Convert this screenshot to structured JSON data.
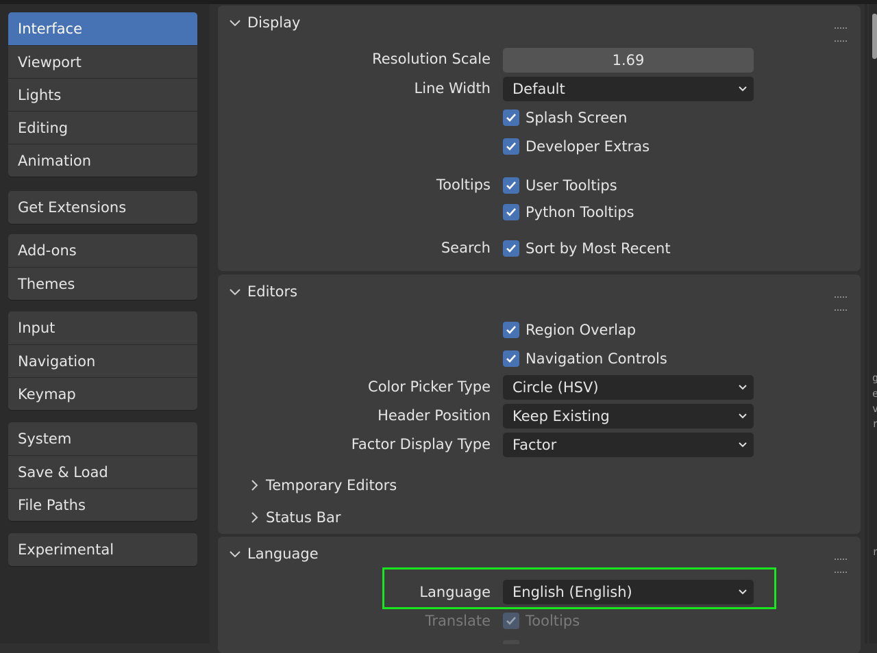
{
  "sidebar": {
    "groups": [
      [
        "Interface",
        "Viewport",
        "Lights",
        "Editing",
        "Animation"
      ],
      [
        "Get Extensions"
      ],
      [
        "Add-ons",
        "Themes"
      ],
      [
        "Input",
        "Navigation",
        "Keymap"
      ],
      [
        "System",
        "Save & Load",
        "File Paths"
      ],
      [
        "Experimental"
      ]
    ],
    "active": "Interface"
  },
  "display": {
    "title": "Display",
    "resolution_scale_label": "Resolution Scale",
    "resolution_scale_value": "1.69",
    "line_width_label": "Line Width",
    "line_width_value": "Default",
    "splash_screen": "Splash Screen",
    "developer_extras": "Developer Extras",
    "tooltips_label": "Tooltips",
    "user_tooltips": "User Tooltips",
    "python_tooltips": "Python Tooltips",
    "search_label": "Search",
    "sort_recent": "Sort by Most Recent"
  },
  "editors": {
    "title": "Editors",
    "region_overlap": "Region Overlap",
    "navigation_controls": "Navigation Controls",
    "color_picker_label": "Color Picker Type",
    "color_picker_value": "Circle (HSV)",
    "header_position_label": "Header Position",
    "header_position_value": "Keep Existing",
    "factor_display_label": "Factor Display Type",
    "factor_display_value": "Factor",
    "temporary_editors": "Temporary Editors",
    "status_bar": "Status Bar"
  },
  "language": {
    "title": "Language",
    "language_label": "Language",
    "language_value": "English (English)",
    "translate_label": "Translate",
    "tooltips": "Tooltips"
  },
  "edge_glyphs": [
    "g",
    "e",
    "v",
    "r",
    "r"
  ],
  "colors": {
    "accent": "#4772b3",
    "highlight": "#19e61e",
    "panel": "#3d3d3d",
    "field": "#282828"
  }
}
